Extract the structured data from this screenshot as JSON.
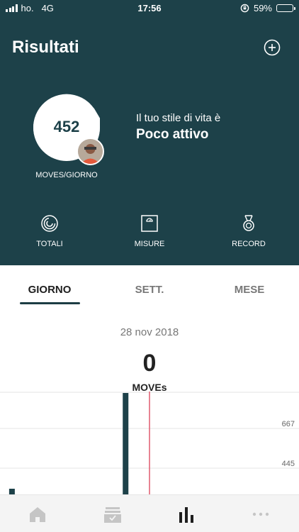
{
  "status_bar": {
    "carrier": "ho.",
    "network": "4G",
    "time": "17:56",
    "battery": "59%",
    "battery_level": 0.59
  },
  "header": {
    "title": "Risultati"
  },
  "summary": {
    "score_value": "452",
    "score_label": "MOVES/GIORNO",
    "lifestyle_label": "Il tuo stile di vita è",
    "lifestyle_value": "Poco attivo"
  },
  "actions": [
    {
      "label": "TOTALI",
      "icon": "rings-icon"
    },
    {
      "label": "MISURE",
      "icon": "scale-icon"
    },
    {
      "label": "RECORD",
      "icon": "medal-icon"
    }
  ],
  "tabs": [
    {
      "label": "GIORNO",
      "active": true
    },
    {
      "label": "SETT.",
      "active": false
    },
    {
      "label": "MESE",
      "active": false
    }
  ],
  "day_view": {
    "date": "28 nov 2018",
    "moves_value": "0",
    "moves_unit": "MOVEs"
  },
  "chart_data": {
    "type": "bar",
    "gridlines": [
      {
        "value": 667,
        "label": "667"
      },
      {
        "value": 445,
        "label": "445"
      }
    ],
    "values": [
      {
        "x": 0.04,
        "value": 330
      },
      {
        "x": 0.42,
        "value": 870
      }
    ],
    "current_marker_x": 0.5,
    "bar_color": "#1d4149",
    "marker_color": "#e05a6e"
  },
  "bottom_nav": [
    {
      "icon": "home-icon",
      "active": false
    },
    {
      "icon": "inbox-icon",
      "active": false
    },
    {
      "icon": "results-icon",
      "active": true
    },
    {
      "icon": "more-icon",
      "active": false
    }
  ],
  "colors": {
    "primary": "#1d4149",
    "accent_red": "#e05a6e"
  }
}
